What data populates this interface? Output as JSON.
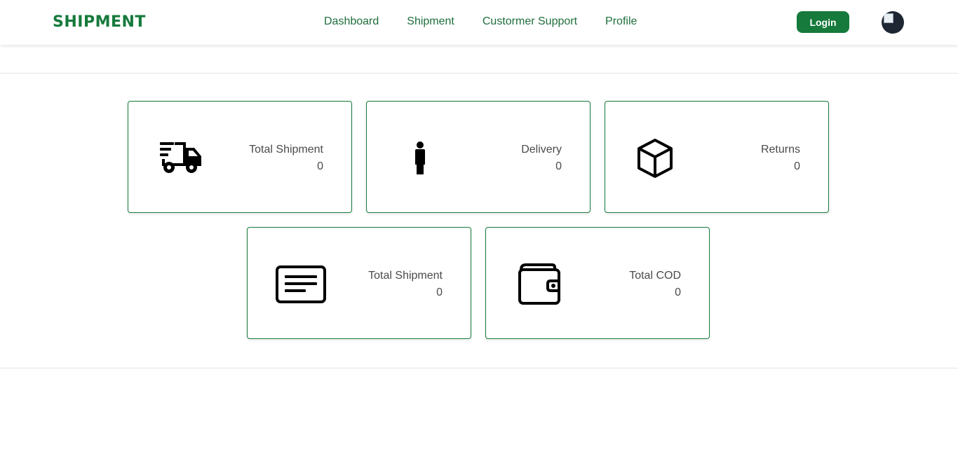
{
  "header": {
    "brand": "SHIPMENT",
    "nav": [
      {
        "label": "Dashboard"
      },
      {
        "label": "Shipment"
      },
      {
        "label": "Custormer Support"
      },
      {
        "label": "Profile"
      }
    ],
    "login_label": "Login",
    "avatar_icon": "user-avatar"
  },
  "colors": {
    "brand_green": "#157a3b",
    "nav_text": "#1f6e3c",
    "card_border": "#157a3b",
    "muted_text": "#4a4a4a"
  },
  "cards": [
    {
      "label": "Total Shipment",
      "value": "0",
      "icon": "truck-icon"
    },
    {
      "label": "Delivery",
      "value": "0",
      "icon": "person-icon"
    },
    {
      "label": "Returns",
      "value": "0",
      "icon": "box-icon"
    },
    {
      "label": "Total Shipment",
      "value": "0",
      "icon": "card-text-icon"
    },
    {
      "label": "Total COD",
      "value": "0",
      "icon": "wallet-icon"
    }
  ]
}
